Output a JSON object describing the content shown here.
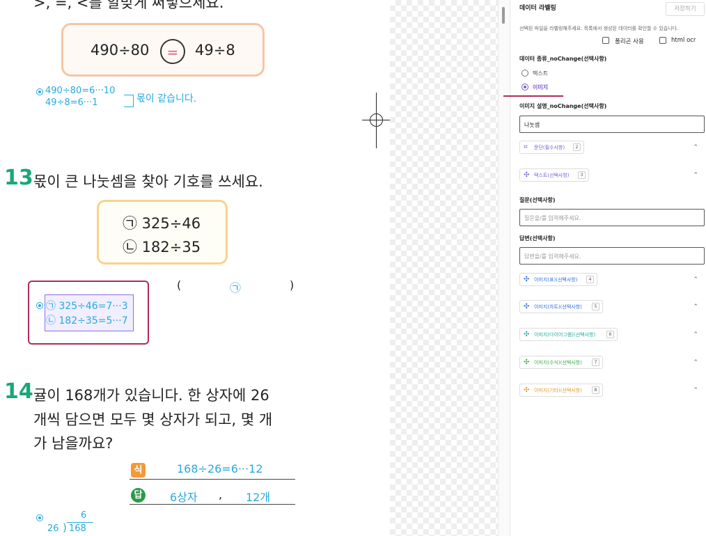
{
  "document": {
    "top_instruction": ">, =, <를 알맞게 써넣으세요.",
    "q12": {
      "left": "490÷80",
      "symbol": "=",
      "right": "49÷8",
      "answer_line1": "490÷80=6···10",
      "answer_line2": "49÷8=6···1",
      "answer_note": "몫이 같습니다."
    },
    "q13": {
      "number": "13",
      "text": "몫이 큰 나눗셈을 찾아 기호를 쓰세요.",
      "option1": "㉠ 325÷46",
      "option2": "㉡ 182÷35",
      "paren_open": "(",
      "answer": "㉠",
      "paren_close": ")",
      "solution1": "㉠ 325÷46=7···3",
      "solution2": "㉡ 182÷35=5···7"
    },
    "q14": {
      "number": "14",
      "line1": "귤이 168개가 있습니다. 한 상자에 26",
      "line2": "개씩 담으면 모두 몇 상자가 되고, 몇 개",
      "line3": "가 남을까요?",
      "sik_label": "식",
      "sik_answer": "168÷26=6···12",
      "dap_label": "답",
      "dap_box": "6상자",
      "dap_comma": ",",
      "dap_rest": "12개",
      "div_quotient": "6",
      "div_divisor": "26",
      "div_dividend": "168"
    }
  },
  "panel": {
    "title": "데이터 라벨링",
    "save_button": "저장하기",
    "description": "선택된 파일을 라벨링해주세요. 목록에서 생성된 데이터를 확인할 수 있습니다.",
    "polygon_label": "폴리곤 사용",
    "html_ocr_label": "html ocr",
    "data_type_title": "데이터 종류_noChange(선택사항)",
    "radio_text": "텍스트",
    "radio_image": "이미지",
    "image_desc_title": "이미지 설명_noChange(선택사항)",
    "image_desc_value": "나눗셈",
    "sections": [
      {
        "label": "문단(필수사항)",
        "count": "2",
        "color": "#7b5ad6",
        "icon": "paragraph-icon"
      },
      {
        "label": "텍스트(선택사항)",
        "count": "3",
        "color": "#7b5ad6",
        "icon": "text-icon"
      },
      {
        "label": "이미지(표)(선택사항)",
        "count": "4",
        "color": "#2f6fd8",
        "icon": "table-icon"
      },
      {
        "label": "이미지(차트)(선택사항)",
        "count": "5",
        "color": "#2f6fd8",
        "icon": "chart-icon"
      },
      {
        "label": "이미지(다이어그램)(선택사항)",
        "count": "6",
        "color": "#1ea9a0",
        "icon": "diagram-icon"
      },
      {
        "label": "이미지(수식)(선택사항)",
        "count": "7",
        "color": "#3aa848",
        "icon": "formula-icon"
      },
      {
        "label": "이미지(기타)(선택사항)",
        "count": "8",
        "color": "#e0962a",
        "icon": "etc-icon"
      }
    ],
    "question_title": "질문(선택사항)",
    "question_placeholder": "질문을/를 입력해주세요.",
    "answer_title": "답변(선택사항)",
    "answer_placeholder": "답변을/를 입력해주세요.",
    "accent": "#7b5ad6"
  }
}
